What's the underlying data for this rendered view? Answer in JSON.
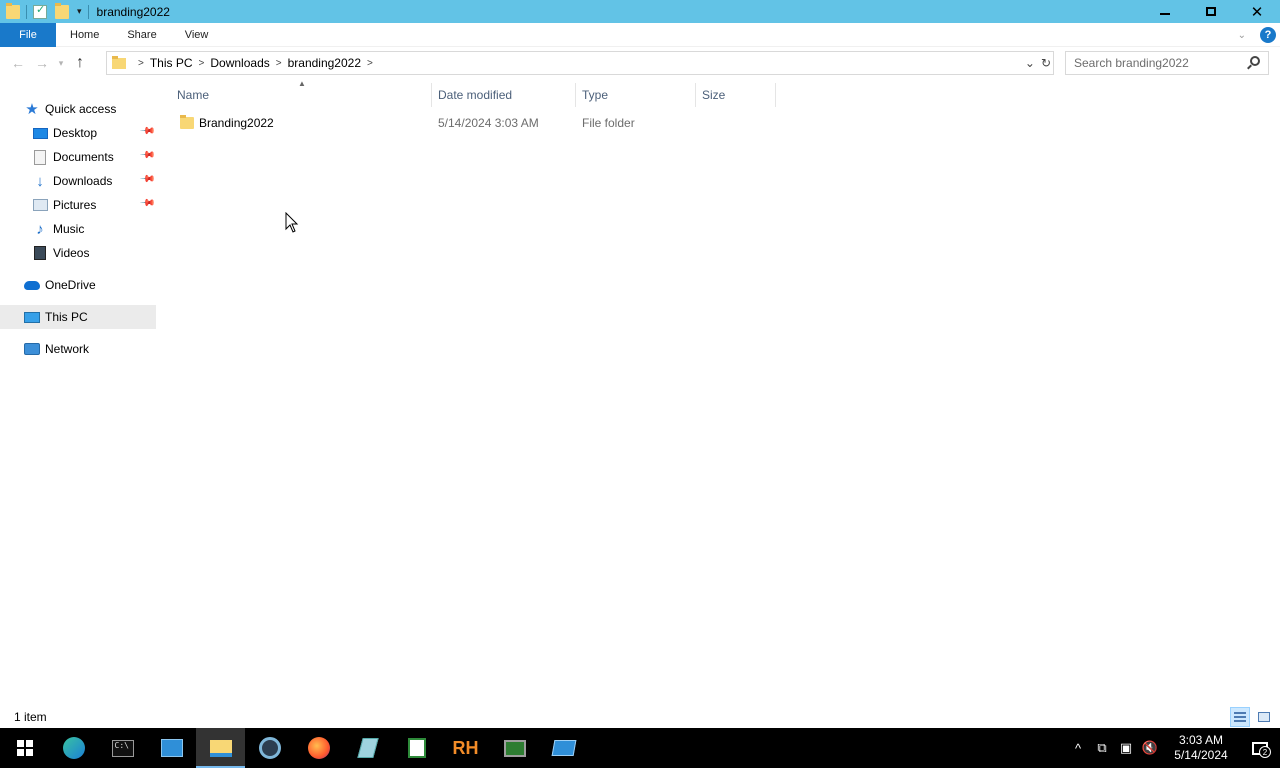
{
  "window": {
    "title": "branding2022",
    "minimize_glyph": "",
    "close_glyph": "✕"
  },
  "ribbon": {
    "tabs": [
      "File",
      "Home",
      "Share",
      "View"
    ],
    "expand_glyph": "⌄",
    "help_glyph": "?"
  },
  "address": {
    "crumbs": [
      "This PC",
      "Downloads",
      "branding2022"
    ],
    "dropdown_glyph": "⌄",
    "refresh_glyph": "↻"
  },
  "search": {
    "placeholder": "Search branding2022"
  },
  "nav_pane": {
    "quick_access": "Quick access",
    "items": [
      {
        "label": "Desktop",
        "icon": "desktop-icon",
        "pinned": true
      },
      {
        "label": "Documents",
        "icon": "documents-icon",
        "pinned": true
      },
      {
        "label": "Downloads",
        "icon": "downloads-icon",
        "pinned": true
      },
      {
        "label": "Pictures",
        "icon": "pictures-icon",
        "pinned": true
      },
      {
        "label": "Music",
        "icon": "music-icon",
        "pinned": false
      },
      {
        "label": "Videos",
        "icon": "videos-icon",
        "pinned": false
      }
    ],
    "onedrive": "OneDrive",
    "this_pc": "This PC",
    "network": "Network",
    "selected": "This PC"
  },
  "file_list": {
    "columns": [
      "Name",
      "Date modified",
      "Type",
      "Size"
    ],
    "sort_column": "Name",
    "rows": [
      {
        "name": "Branding2022",
        "date_modified": "5/14/2024 3:03 AM",
        "type": "File folder",
        "size": ""
      }
    ]
  },
  "status": {
    "item_count": "1 item"
  },
  "taskbar": {
    "apps": [
      "start-icon",
      "edge-icon",
      "cmd-icon",
      "control-panel-icon",
      "file-explorer-icon",
      "chrome-icon",
      "firefox-icon",
      "notepad-icon",
      "spreadsheet-icon",
      "rh-icon",
      "monitor-icon",
      "remote-desktop-icon"
    ],
    "active_app": "file-explorer-icon",
    "time": "3:03 AM",
    "date": "5/14/2024",
    "notification_count": "2",
    "rh_label": "RH",
    "cmd_prompt": "C:\\",
    "tray_up_glyph": "^"
  },
  "colors": {
    "titlebar": "#62c3e6",
    "file_tab": "#1979ca",
    "selected_nav": "#ebebeb",
    "header_text": "#4c607a",
    "taskbar": "#000000"
  }
}
